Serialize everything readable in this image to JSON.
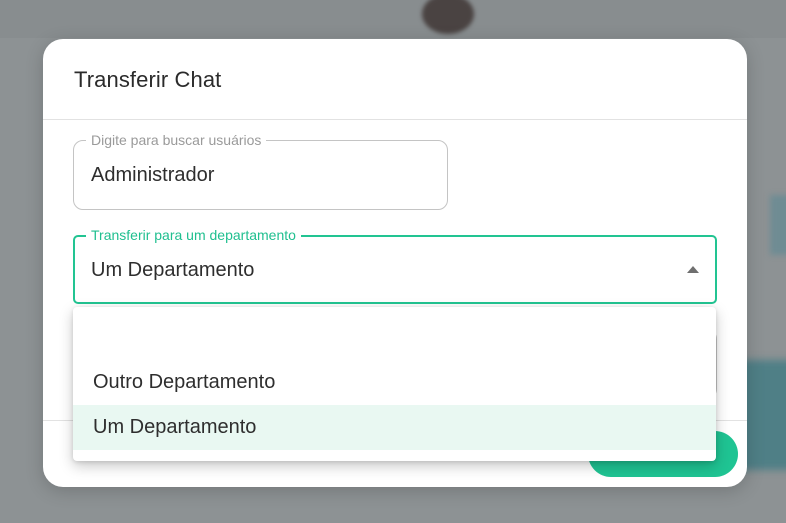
{
  "dialog": {
    "title": "Transferir Chat"
  },
  "user_search": {
    "label": "Digite para buscar usuários",
    "value": "Administrador"
  },
  "department_select": {
    "label": "Transferir para um departamento",
    "value": "Um Departamento",
    "expanded": true,
    "accent_color": "#22c492"
  },
  "department_options": [
    {
      "label": "",
      "selected": false
    },
    {
      "label": "Outro Departamento",
      "selected": false
    },
    {
      "label": "Um Departamento",
      "selected": true
    }
  ]
}
